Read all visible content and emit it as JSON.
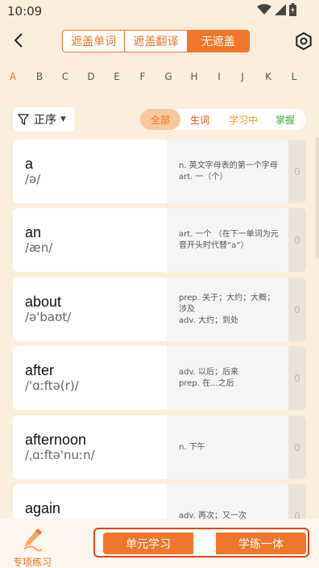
{
  "status": {
    "time": "10:09"
  },
  "header": {
    "mask_options": [
      "遮盖单词",
      "遮盖翻译",
      "无遮盖"
    ],
    "selected_mask": "无遮盖"
  },
  "alphabet": {
    "letters": [
      "A",
      "B",
      "C",
      "D",
      "E",
      "F",
      "G",
      "H",
      "I",
      "J",
      "K",
      "L"
    ],
    "active": "A"
  },
  "filters": {
    "order_label": "正序",
    "tabs": [
      "全部",
      "生词",
      "学习中",
      "掌握"
    ],
    "active_tab": "全部"
  },
  "words": [
    {
      "word": "a",
      "phonetic": "/ə/",
      "meaning": "n. 英文字母表的第一个字母\nart. 一（个）",
      "count": "0"
    },
    {
      "word": "an",
      "phonetic": "/æn/",
      "meaning": "art. 一个 （在下一单词为元音开头时代替“a”）",
      "count": "0"
    },
    {
      "word": "about",
      "phonetic": "/ə'baʊt/",
      "meaning": "prep. 关于；大约；大概；涉及\nadv. 大约；到处",
      "count": "0"
    },
    {
      "word": "after",
      "phonetic": "/'ɑːftə(r)/",
      "meaning": "adv. 以后；后来\nprep. 在...之后",
      "count": "0"
    },
    {
      "word": "afternoon",
      "phonetic": "/ˌɑːftə'nuːn/",
      "meaning": "n. 下午",
      "count": "0"
    },
    {
      "word": "again",
      "phonetic": "",
      "meaning": "adv. 再次；又一次",
      "count": "0"
    }
  ],
  "bottom": {
    "practice_label": "专项练习",
    "unit_study_label": "单元学习",
    "integrated_label": "学练一体"
  },
  "colors": {
    "accent": "#f0762b",
    "background": "#fbeedd",
    "new_word": "#e8491f",
    "learning": "#f0a020",
    "mastered": "#4cae4c"
  }
}
